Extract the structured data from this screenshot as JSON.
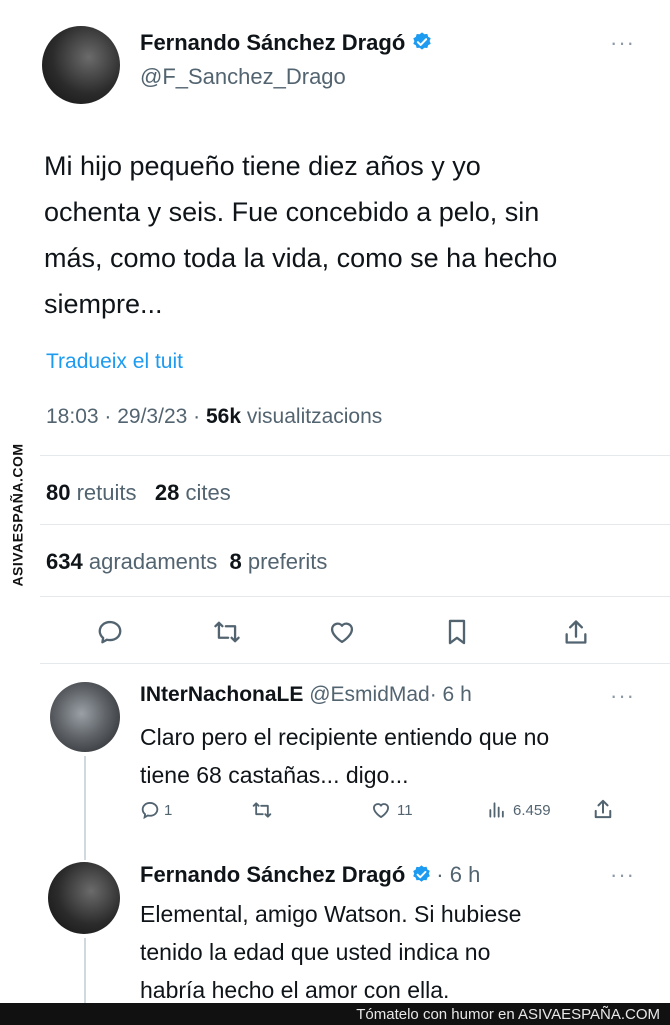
{
  "tweet": {
    "author_name": "Fernando Sánchez Dragó",
    "author_handle": "@F_Sanchez_Drago",
    "more": "···",
    "text_lines": [
      "Mi hijo pequeño tiene diez años y yo",
      "ochenta y seis. Fue concebido a pelo, sin",
      "más, como toda la vida, como se ha hecho",
      "siempre..."
    ],
    "translate": "Tradueix el tuit",
    "time": "18:03",
    "date": "29/3/23",
    "views_count": "56k",
    "views_label": "visualitzacions",
    "retweets_count": "80",
    "retweets_label": "retuits",
    "quotes_count": "28",
    "quotes_label": "cites",
    "likes_count": "634",
    "likes_label": "agradaments",
    "bookmarks_count": "8",
    "bookmarks_label": "preferits"
  },
  "reply1": {
    "author_name": "INterNachonaLE",
    "author_handle": "@EsmidMad",
    "time": "· 6 h",
    "more": "···",
    "text_lines": [
      "Claro pero el recipiente entiendo que no",
      "tiene 68 castañas... digo..."
    ],
    "replies": "1",
    "likes": "11",
    "views": "6.459"
  },
  "reply2": {
    "author_name": "Fernando Sánchez Dragó",
    "time": "· 6 h",
    "more": "···",
    "text_lines": [
      "Elemental, amigo Watson. Si hubiese",
      "tenido la edad que usted indica no",
      "habría hecho el amor con ella."
    ]
  },
  "watermark_side": "ASIVAESPAÑA.COM",
  "footer_text": "Tómatelo con humor en ASIVAESPAÑA.COM",
  "colors": {
    "verified": "#1d9bf0",
    "link": "#1d9bf0",
    "secondary": "#536471"
  }
}
